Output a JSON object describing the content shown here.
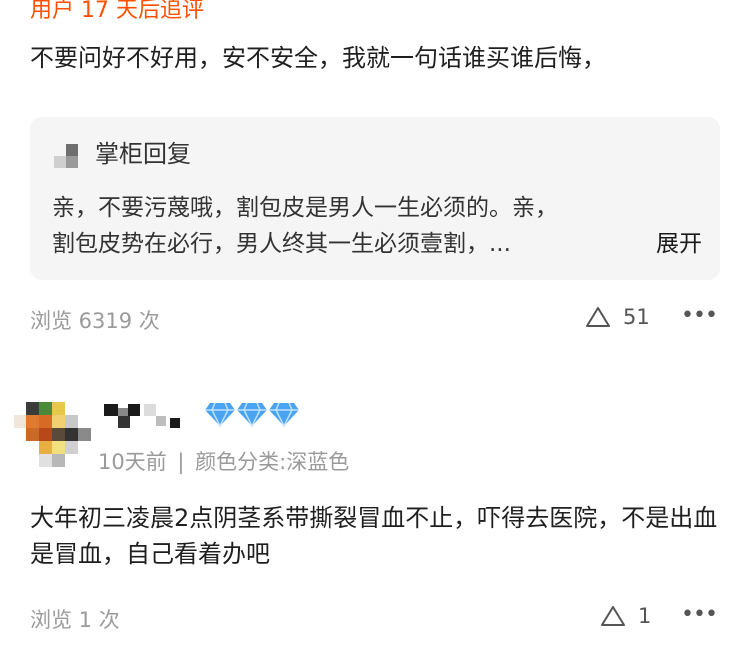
{
  "review1": {
    "header_cut": "用户 17 天后追评",
    "text": "不要问好不好用，安不安全，我就一句话谁买谁后悔，",
    "reply": {
      "title": "掌柜回复",
      "line1": "亲，不要污蔑哦，割包皮是男人一生必须的。亲，",
      "line2": "割包皮势在必行，男人终其一生必须壹割，...",
      "expand": "展开"
    },
    "views": "浏览 6319 次",
    "likes": "51",
    "more": "•••"
  },
  "review2": {
    "time": "10天前",
    "divider": "|",
    "variant": "颜色分类:深蓝色",
    "text": "大年初三凌晨2点阴茎系带撕裂冒血不止，吓得去医院，不是出血是冒血，自己看着办吧",
    "views": "浏览 1 次",
    "likes": "1",
    "more": "•••",
    "member_badge": "diamond-icon x3"
  },
  "colors": {
    "accent": "#ff5000",
    "meta": "#9a9a9a",
    "reply_bg": "#f5f5f5",
    "diamond": "#4aa3f0"
  }
}
